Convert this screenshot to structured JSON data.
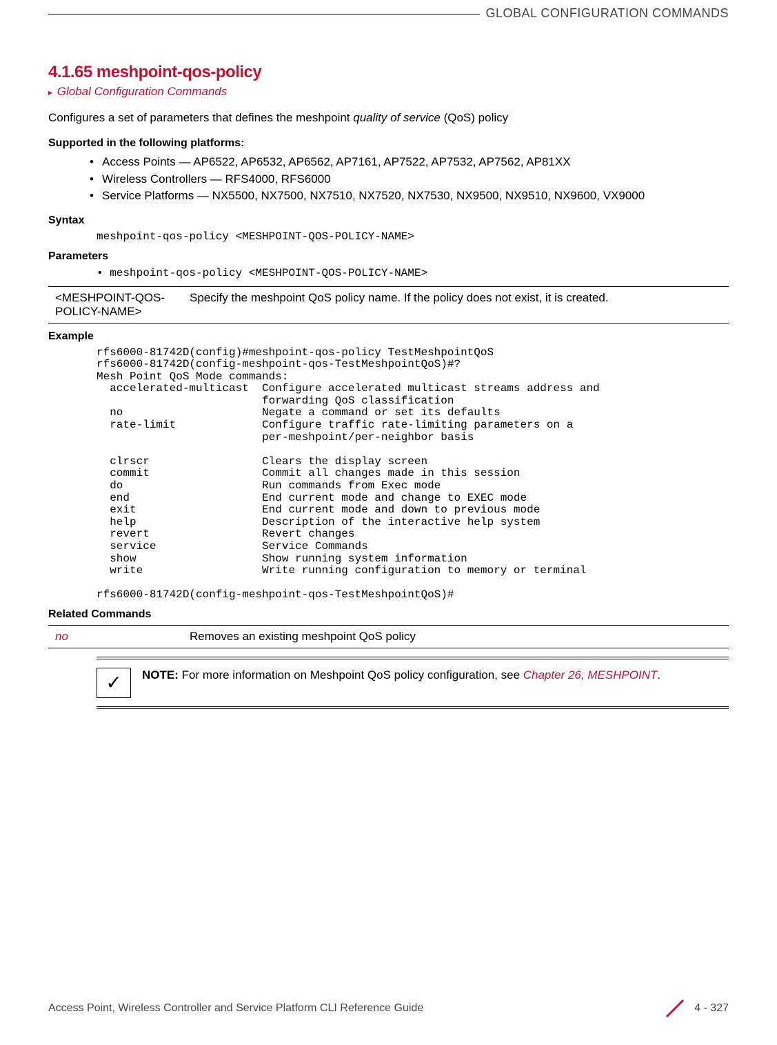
{
  "header": {
    "category": "GLOBAL CONFIGURATION COMMANDS"
  },
  "section": {
    "number": "4.1.65",
    "title": "meshpoint-qos-policy",
    "breadcrumb": "Global Configuration Commands",
    "intro_pre": "Configures a set of parameters that defines the meshpoint ",
    "intro_ital": "quality of service",
    "intro_post": " (QoS) policy"
  },
  "platforms": {
    "heading": "Supported in the following platforms:",
    "items": [
      "Access Points — AP6522, AP6532, AP6562, AP7161, AP7522, AP7532, AP7562, AP81XX",
      "Wireless Controllers — RFS4000, RFS6000",
      "Service Platforms — NX5500, NX7500, NX7510, NX7520, NX7530, NX9500, NX9510, NX9600, VX9000"
    ]
  },
  "syntax": {
    "heading": "Syntax",
    "code": "meshpoint-qos-policy <MESHPOINT-QOS-POLICY-NAME>"
  },
  "parameters": {
    "heading": "Parameters",
    "bullet": "• meshpoint-qos-policy <MESHPOINT-QOS-POLICY-NAME>",
    "row_key": "<MESHPOINT-QOS-POLICY-NAME>",
    "row_desc": "Specify the meshpoint QoS policy name. If the policy does not exist, it is created."
  },
  "example": {
    "heading": "Example",
    "code": "rfs6000-81742D(config)#meshpoint-qos-policy TestMeshpointQoS\nrfs6000-81742D(config-meshpoint-qos-TestMeshpointQoS)#?\nMesh Point QoS Mode commands:\n  accelerated-multicast  Configure accelerated multicast streams address and\n                         forwarding QoS classification\n  no                     Negate a command or set its defaults\n  rate-limit             Configure traffic rate-limiting parameters on a\n                         per-meshpoint/per-neighbor basis\n\n  clrscr                 Clears the display screen\n  commit                 Commit all changes made in this session\n  do                     Run commands from Exec mode\n  end                    End current mode and change to EXEC mode\n  exit                   End current mode and down to previous mode\n  help                   Description of the interactive help system\n  revert                 Revert changes\n  service                Service Commands\n  show                   Show running system information\n  write                  Write running configuration to memory or terminal\n\nrfs6000-81742D(config-meshpoint-qos-TestMeshpointQoS)#"
  },
  "related": {
    "heading": "Related Commands",
    "cmd": "no",
    "desc": "Removes an existing meshpoint QoS policy"
  },
  "note": {
    "label": "NOTE:",
    "text": " For more information on Meshpoint QoS policy configuration, see ",
    "chapter": "Chapter 26, MESHPOINT",
    "period": "."
  },
  "footer": {
    "guide": "Access Point, Wireless Controller and Service Platform CLI Reference Guide",
    "page": "4 - 327"
  }
}
